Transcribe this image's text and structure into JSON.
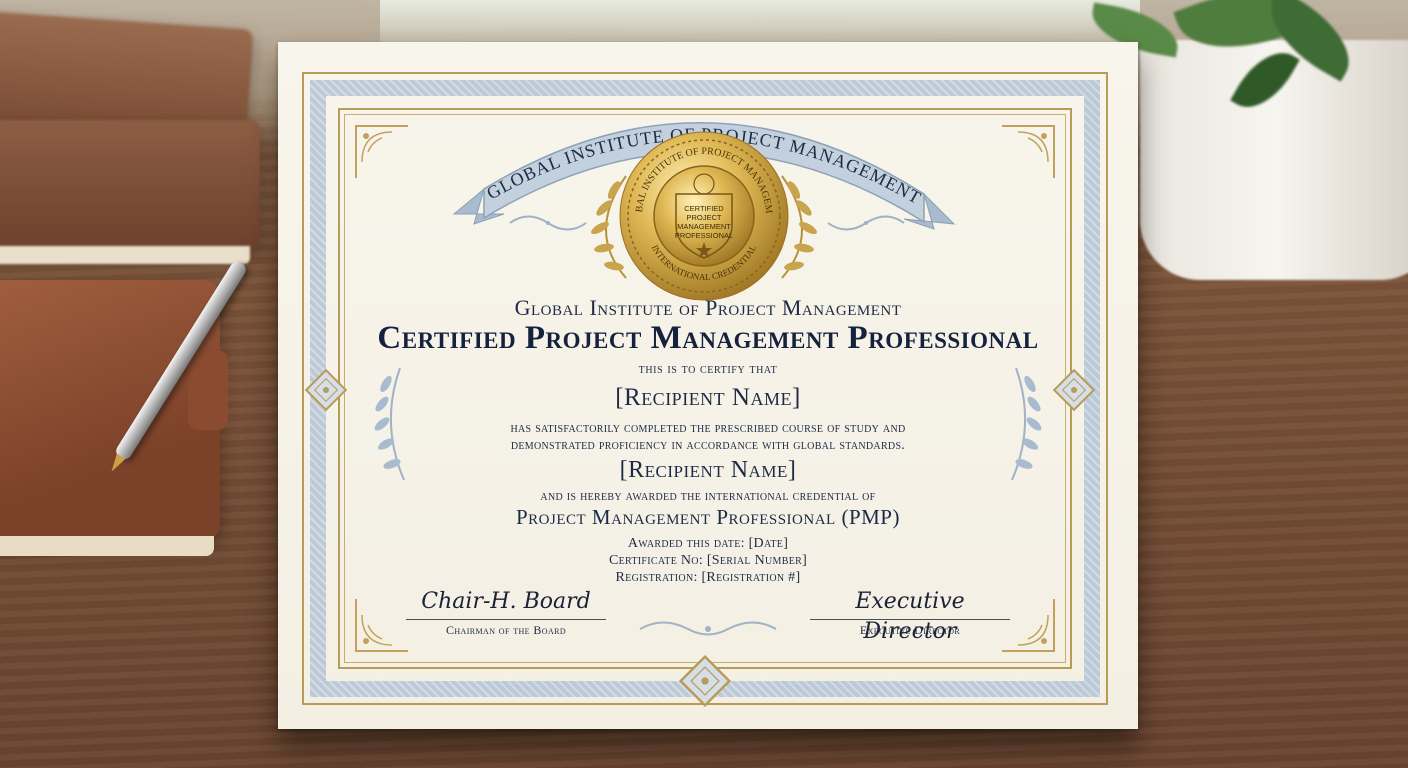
{
  "certificate": {
    "ribbon_text": "GLOBAL INSTITUTE OF PROJECT MANAGEMENT",
    "seal": {
      "ring_top": "GLOBAL INSTITUTE OF PROJECT MANAGEMENT",
      "ring_bottom": "INTERNATIONAL CREDENTIAL",
      "center_line1": "CERTIFIED",
      "center_line2": "PROJECT",
      "center_line3": "MANAGEMENT",
      "center_line4": "PROFESSIONAL"
    },
    "institute": "Global Institute of Project Management",
    "title": "Certified Project Management Professional",
    "certify_line": "this is to certify that",
    "recipient_name": "[Recipient Name]",
    "completed_line1": "has satisfactorily completed the prescribed course of study and",
    "completed_line2": "demonstrated proficiency in accordance with global standards.",
    "recipient_name_2": "[Recipient Name]",
    "awarded_line": "and is hereby awarded the international credential of",
    "credential": "Project Management Professional (PMP)",
    "awarded_date": "Awarded this date: [Date]",
    "certificate_no": "Certificate No: [Serial Number]",
    "registration": "Registration: [Registration #]",
    "signature_left": {
      "signature": "Chair-H. Board",
      "title": "Chairman of the Board"
    },
    "signature_right": {
      "signature": "Executive Director",
      "title": "Executive Director"
    }
  },
  "colors": {
    "border_blue": "#bcc9d6",
    "gold": "#c9a44e",
    "ink": "#1d2a44",
    "paper": "#f6f2e7"
  }
}
